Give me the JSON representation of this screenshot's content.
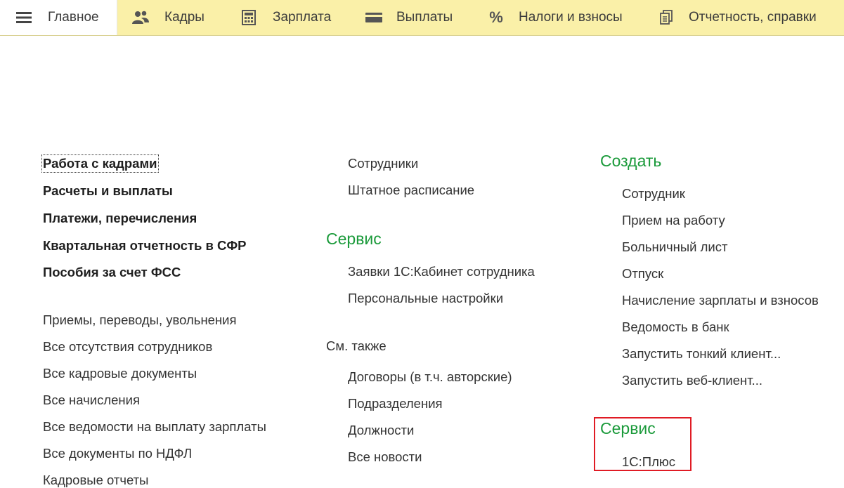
{
  "topbar": {
    "tabs": [
      {
        "label": "Главное",
        "icon": "hamburger-menu-icon"
      },
      {
        "label": "Кадры",
        "icon": "people-icon"
      },
      {
        "label": "Зарплата",
        "icon": "calculator-icon"
      },
      {
        "label": "Выплаты",
        "icon": "card-icon"
      },
      {
        "label": "Налоги и взносы",
        "icon": "percent-icon"
      },
      {
        "label": "Отчетность, справки",
        "icon": "documents-icon"
      }
    ]
  },
  "left": {
    "bold_links": [
      "Работа с кадрами",
      "Расчеты и выплаты",
      "Платежи, перечисления",
      "Квартальная отчетность в СФР",
      "Пособия за счет ФСС"
    ],
    "links": [
      "Приемы, переводы, увольнения",
      "Все отсутствия сотрудников",
      "Все кадровые документы",
      "Все начисления",
      "Все ведомости на выплату зарплаты",
      "Все документы по НДФЛ",
      "Кадровые отчеты"
    ]
  },
  "middle": {
    "top_links": [
      "Сотрудники",
      "Штатное расписание"
    ],
    "service_title": "Сервис",
    "service_links": [
      "Заявки 1С:Кабинет сотрудника",
      "Персональные настройки"
    ],
    "see_also_title": "См. также",
    "see_also_links": [
      "Договоры (в т.ч. авторские)",
      "Подразделения",
      "Должности",
      "Все новости"
    ]
  },
  "right": {
    "create_title": "Создать",
    "create_links": [
      "Сотрудник",
      "Прием на работу",
      "Больничный лист",
      "Отпуск",
      "Начисление зарплаты и взносов",
      "Ведомость в банк",
      "Запустить тонкий клиент...",
      "Запустить веб-клиент..."
    ],
    "service_title": "Сервис",
    "service_links": [
      "1С:Плюс"
    ]
  },
  "colors": {
    "topbar_bg": "#faf0a8",
    "section_green": "#1a9a3a",
    "highlight_red": "#e01b24"
  }
}
